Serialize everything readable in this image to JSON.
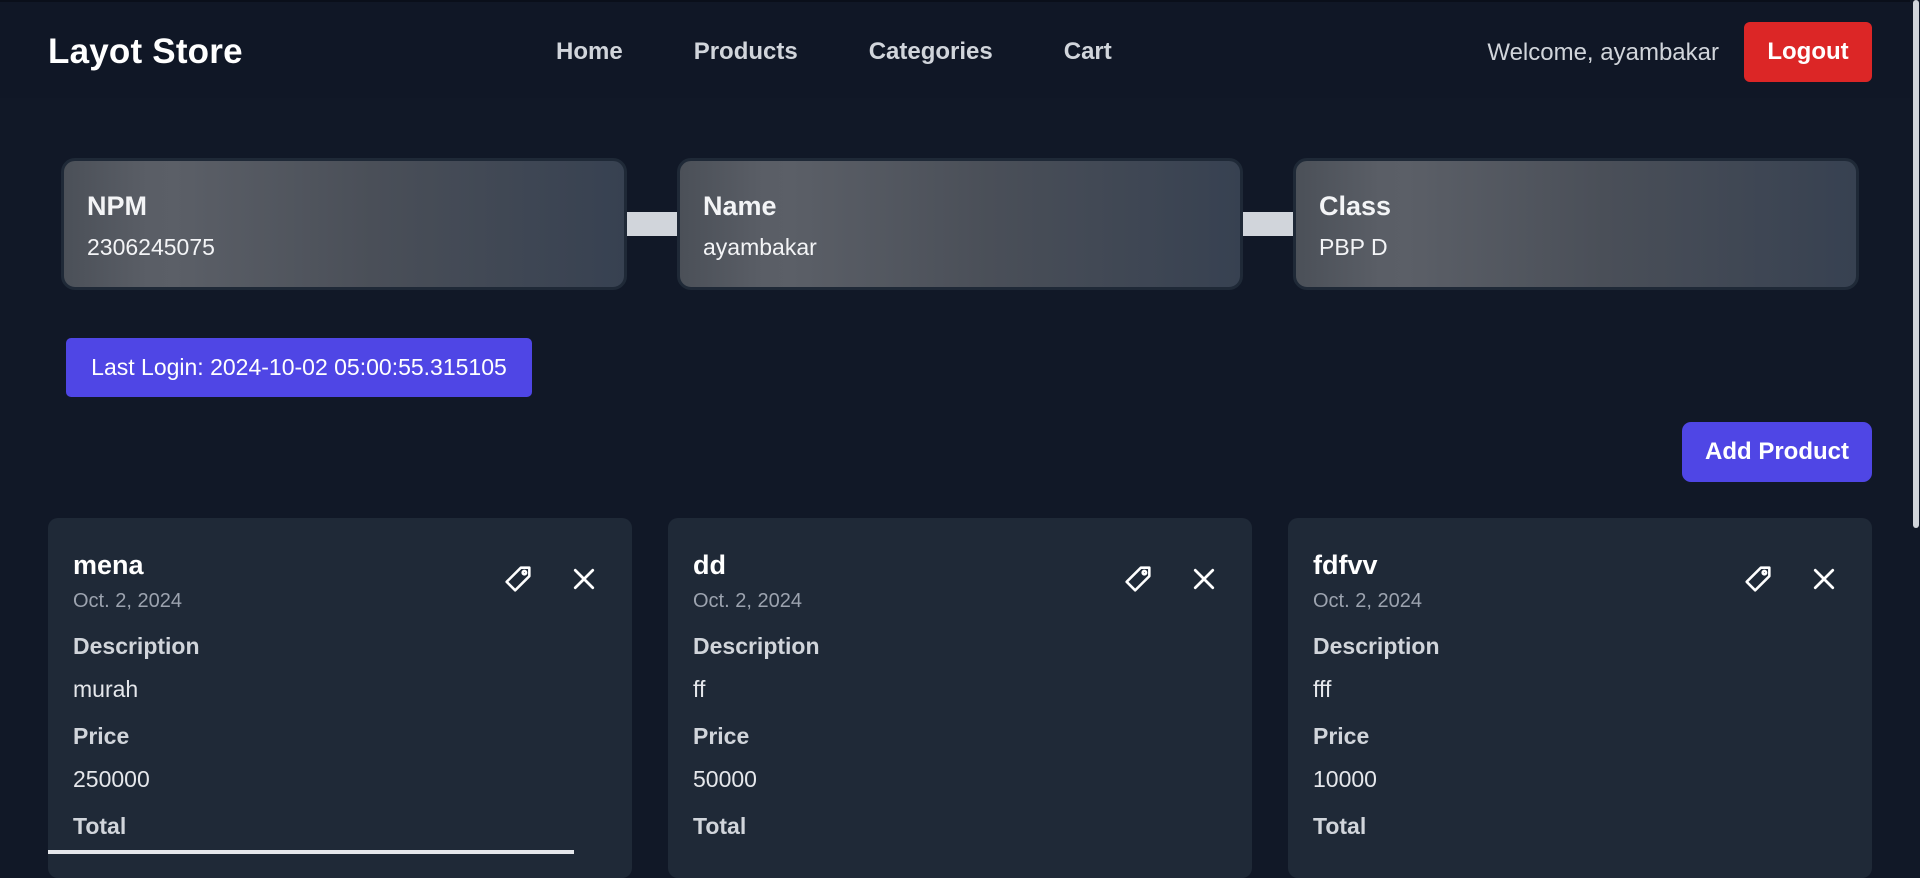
{
  "navbar": {
    "brand": "Layot Store",
    "links": [
      "Home",
      "Products",
      "Categories",
      "Cart"
    ],
    "welcome": "Welcome, ayambakar",
    "logout_label": "Logout"
  },
  "info_cards": [
    {
      "label": "NPM",
      "value": "2306245075"
    },
    {
      "label": "Name",
      "value": "ayambakar"
    },
    {
      "label": "Class",
      "value": "PBP D"
    }
  ],
  "last_login": "Last Login: 2024-10-02 05:00:55.315105",
  "add_product_label": "Add Product",
  "products": [
    {
      "name": "mena",
      "date": "Oct. 2, 2024",
      "description_label": "Description",
      "description": "murah",
      "price_label": "Price",
      "price": "250000",
      "total_label": "Total"
    },
    {
      "name": "dd",
      "date": "Oct. 2, 2024",
      "description_label": "Description",
      "description": "ff",
      "price_label": "Price",
      "price": "50000",
      "total_label": "Total"
    },
    {
      "name": "fdfvv",
      "date": "Oct. 2, 2024",
      "description_label": "Description",
      "description": "fff",
      "price_label": "Price",
      "price": "10000",
      "total_label": "Total"
    }
  ],
  "icons": {
    "edit": "tag-icon",
    "delete": "close-icon"
  },
  "colors": {
    "background": "#111827",
    "navbar": "#101726",
    "card": "#1f2937",
    "accent": "#4f46e5",
    "danger": "#dc2626"
  }
}
